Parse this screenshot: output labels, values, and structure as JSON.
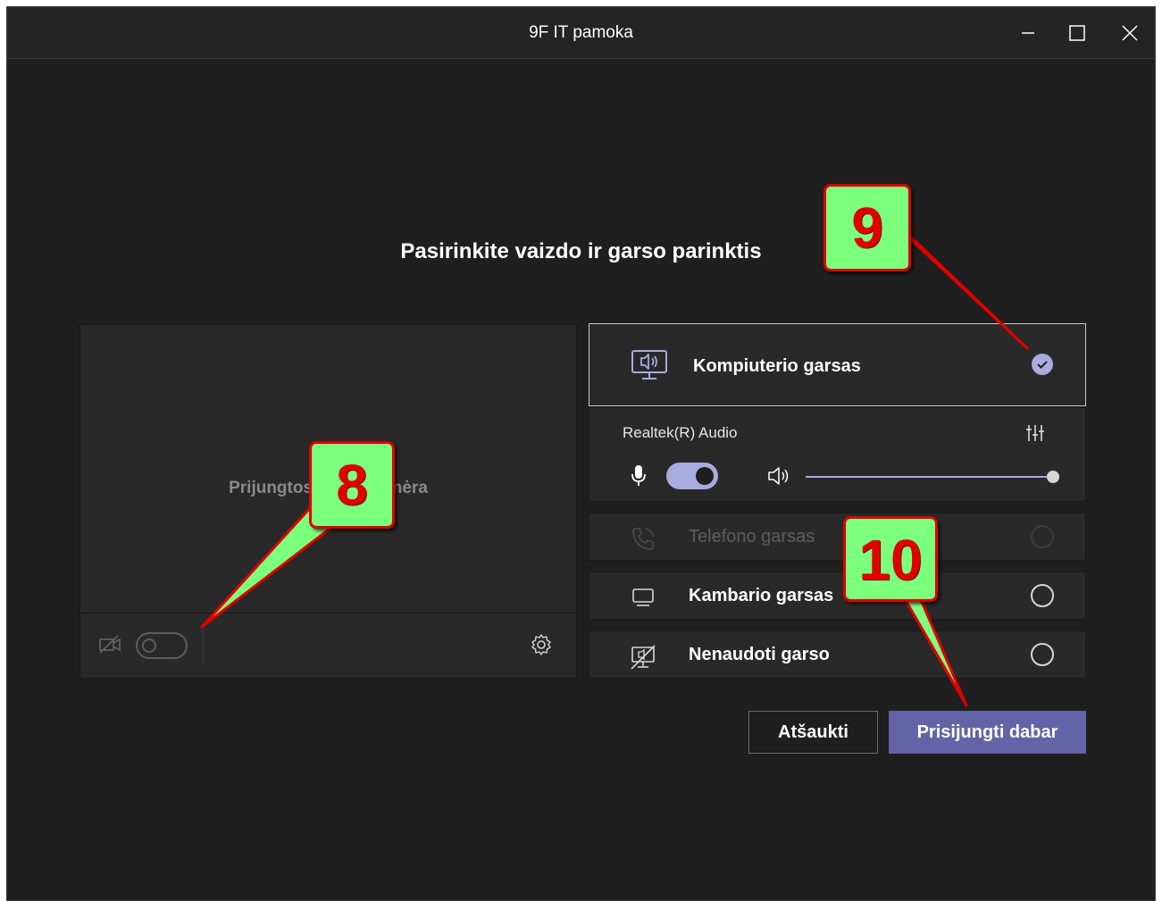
{
  "window": {
    "title": "9F IT pamoka",
    "controls": [
      "minimize-icon",
      "maximize-icon",
      "close-icon"
    ]
  },
  "heading": "Pasirinkite vaizdo ir garso parinktis",
  "video_preview": {
    "message": "Prijungtos kameros nėra",
    "camera_toggle_on": false,
    "icons": [
      "camera-off-icon",
      "gear-icon"
    ]
  },
  "audio_options": {
    "computer_audio": {
      "label": "Kompiuterio garsas",
      "selected": true,
      "icon": "monitor-speaker-icon"
    },
    "device": {
      "name": "Realtek(R) Audio",
      "mic_on": true,
      "speaker_volume_fraction": 1.0,
      "icons": [
        "equalizer-icon",
        "microphone-icon",
        "speaker-icon"
      ]
    },
    "phone_audio": {
      "label": "Telefono garsas",
      "enabled": false,
      "icon": "phone-icon"
    },
    "room_audio": {
      "label": "Kambario garsas",
      "selected": false,
      "icon": "room-device-icon"
    },
    "no_audio": {
      "label": "Nenaudoti garso",
      "selected": false,
      "icon": "no-audio-icon"
    }
  },
  "buttons": {
    "cancel": "Atšaukti",
    "join": "Prisijungti dabar"
  },
  "annotations": {
    "callout_8": "8",
    "callout_9": "9",
    "callout_10": "10"
  },
  "colors": {
    "accent": "#6264a7",
    "accent_light": "#a8acdf",
    "callout_fill": "#7cff7c",
    "callout_border": "#e00000"
  }
}
